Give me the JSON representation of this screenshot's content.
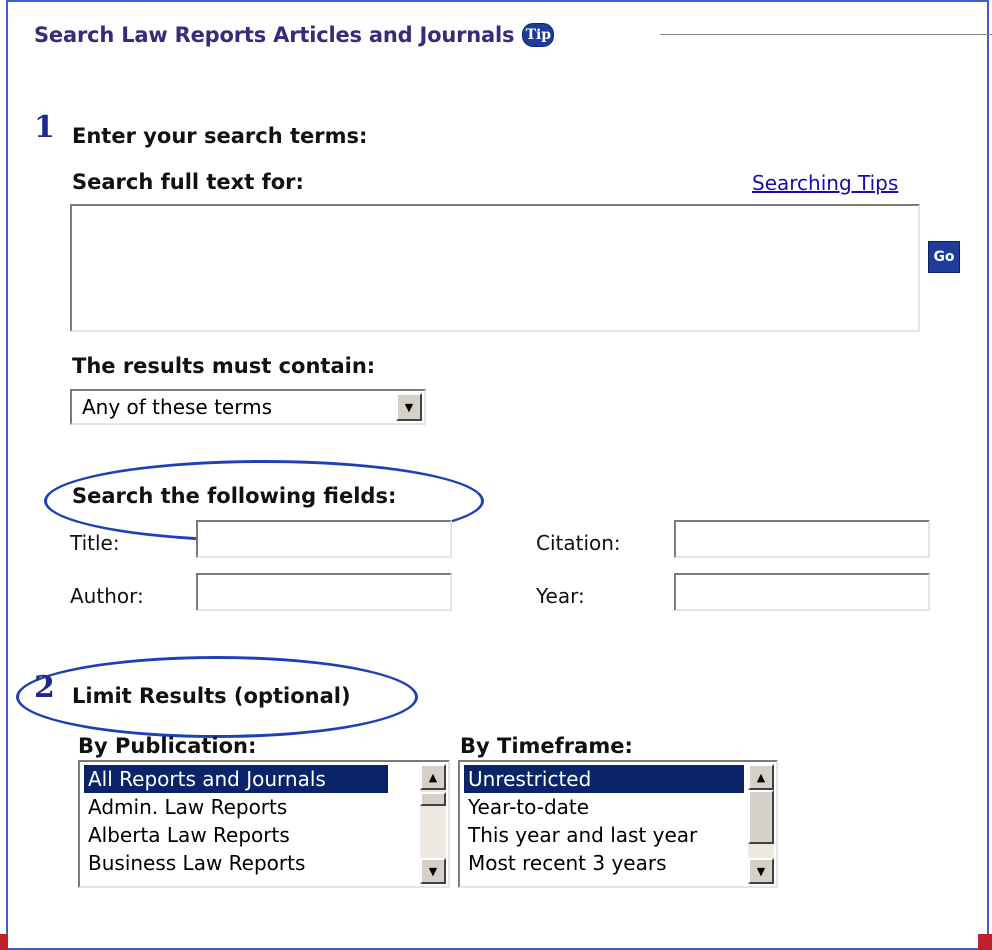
{
  "section": {
    "title": "Search Law Reports Articles and Journals",
    "tip_label": "Tip"
  },
  "step1": {
    "number": "1",
    "heading": "Enter your search terms:",
    "fulltext_label": "Search full text for:",
    "tips_link": "Searching Tips",
    "fulltext_value": "",
    "go_label": "Go",
    "contain_label": "The results must contain:",
    "contain_selected": "Any of these terms"
  },
  "fields": {
    "heading": "Search the following fields:",
    "title_label": "Title:",
    "author_label": "Author:",
    "citation_label": "Citation:",
    "year_label": "Year:"
  },
  "step2": {
    "number": "2",
    "heading": "Limit Results (optional)",
    "publication_label": "By Publication:",
    "publications": [
      "All Reports and Journals",
      "Admin. Law Reports",
      "Alberta Law Reports",
      "Business Law Reports"
    ],
    "timeframe_label": "By Timeframe:",
    "timeframes": [
      "Unrestricted",
      "Year-to-date",
      "This year and last year",
      "Most recent 3 years"
    ]
  },
  "colors": {
    "title": "#3b2a7a",
    "accent": "#1f3c9a",
    "highlight_ellipse": "#1f3fb6",
    "selection": "#0a246a",
    "link": "#1a0dab"
  }
}
